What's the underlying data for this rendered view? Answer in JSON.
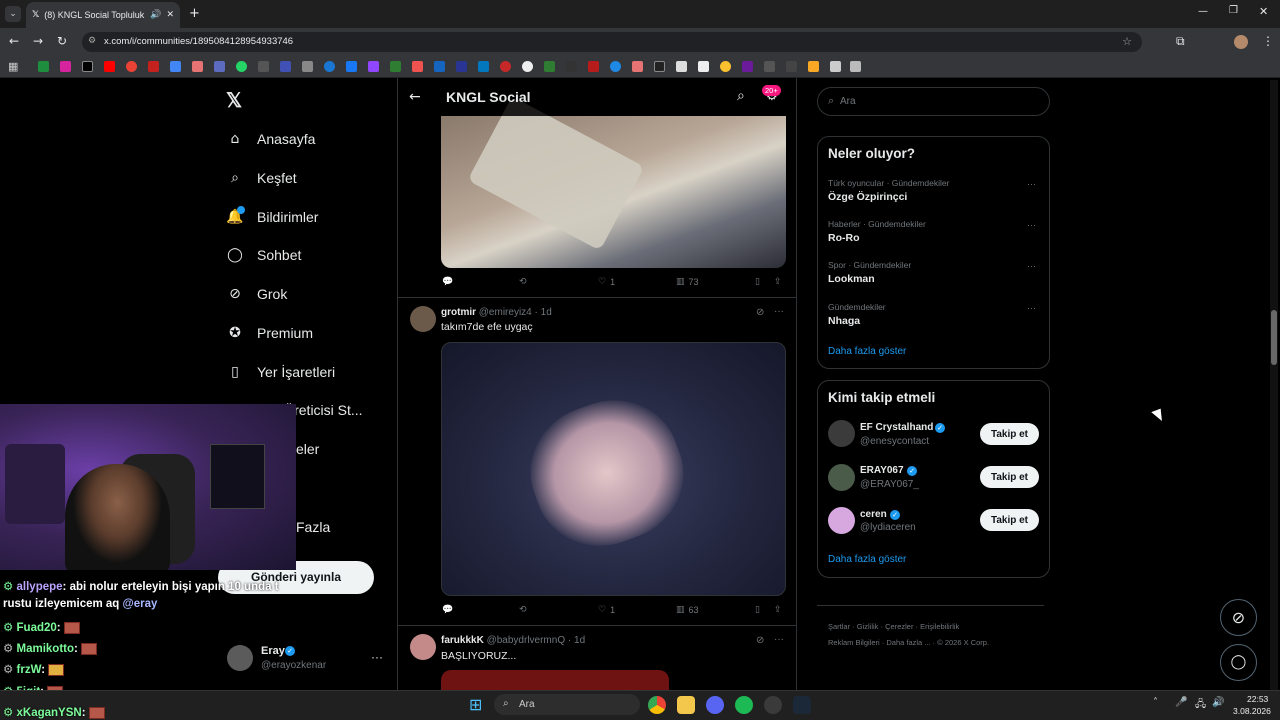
{
  "browser": {
    "tab_title": "(8) KNGL Social Topluluk / X",
    "url": "x.com/i/communities/1895084128954933746"
  },
  "nav": {
    "items": [
      {
        "label": "Anasayfa",
        "icon": "home-icon"
      },
      {
        "label": "Keşfet",
        "icon": "search-icon"
      },
      {
        "label": "Bildirimler",
        "icon": "bell-icon"
      },
      {
        "label": "Sohbet",
        "icon": "chat-icon"
      },
      {
        "label": "Grok",
        "icon": "grok-icon"
      },
      {
        "label": "Premium",
        "icon": "premium-icon"
      },
      {
        "label": "Yer İşaretleri",
        "icon": "bookmark-icon"
      },
      {
        "label": "Üreticisi St...",
        "icon": "creator-icon"
      },
      {
        "label": "eler",
        "icon": "lists-icon"
      },
      {
        "label": "Fazla",
        "icon": "more-icon"
      }
    ],
    "post_button": "Gönderi yayınla",
    "account": {
      "name": "Eray",
      "handle": "@erayozkenar"
    }
  },
  "header": {
    "title": "KNGL Social",
    "badge": "20+"
  },
  "posts": [
    {
      "likes": "1",
      "views": "73"
    },
    {
      "name": "grotmir",
      "handle": "@emireyiz4",
      "time": "1d",
      "text": "takım7de efe uygaç",
      "likes": "1",
      "views": "63"
    },
    {
      "name": "farukkkK",
      "handle": "@babydrlvermnQ",
      "time": "1d",
      "text": "BAŞLIYORUZ..."
    }
  ],
  "search": {
    "placeholder": "Ara"
  },
  "trends": {
    "title": "Neler oluyor?",
    "items": [
      {
        "context": "Türk oyuncular · Gündemdekiler",
        "topic": "Özge Özpirinçci"
      },
      {
        "context": "Haberler · Gündemdekiler",
        "topic": "Ro-Ro"
      },
      {
        "context": "Spor · Gündemdekiler",
        "topic": "Lookman"
      },
      {
        "context": "Gündemdekiler",
        "topic": "Nhaga"
      }
    ],
    "more": "Daha fazla göster"
  },
  "who_to_follow": {
    "title": "Kimi takip etmeli",
    "items": [
      {
        "name": "EF Crystalhand",
        "handle": "@enesycontact",
        "button": "Takip et"
      },
      {
        "name": "ERAY067",
        "handle": "@ERAY067_",
        "button": "Takip et"
      },
      {
        "name": "ceren",
        "handle": "@lydiaceren",
        "button": "Takip et"
      }
    ],
    "more": "Daha fazla göster"
  },
  "footer": {
    "links": [
      "Şartlar",
      "Gizlilik",
      "Çerezler",
      "Erişilebilirlik",
      "Reklam Bilgileri",
      "Daha fazla ...",
      "© 2026 X Corp."
    ]
  },
  "chat_overlay": {
    "messages": [
      {
        "user": "allypepe",
        "text": ": abi nolur erteleyin bişi yapın 10 unda t",
        "user_color": "#b9a4ff"
      },
      {
        "text": "rustu izleyemicem aq",
        "mention": "@eray"
      },
      {
        "user": "Fuad20",
        "text": ":",
        "user_color": "#7cfc9a"
      },
      {
        "user": "Mamikotto",
        "text": ":",
        "user_color": "#7cfc9a"
      },
      {
        "user": "frzW",
        "text": ":",
        "user_color": "#7cfc9a"
      },
      {
        "user": "5igit",
        "text": ":",
        "user_color": "#7cfc9a"
      },
      {
        "user": "xKaganYSN",
        "text": ":",
        "user_color": "#7cfc9a"
      }
    ]
  },
  "taskbar": {
    "search_placeholder": "Ara",
    "time": "22:53",
    "date": "3.08.2026"
  },
  "colors": {
    "accent": "#1d9bf0",
    "pink_badge": "#f91880"
  }
}
